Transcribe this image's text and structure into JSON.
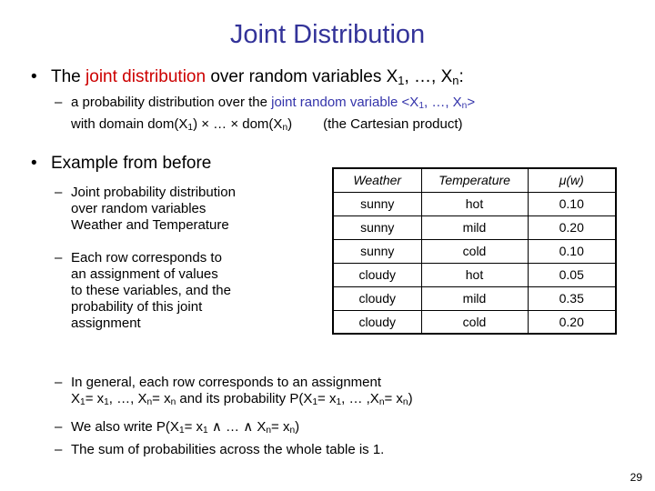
{
  "slide": {
    "title": "Joint Distribution",
    "page_number": "29",
    "colors": {
      "title": "#333399",
      "highlight_red": "#cc0000",
      "highlight_blue": "#3333aa",
      "text": "#000000",
      "background": "#ffffff"
    }
  },
  "bullets": {
    "b1_the_joint": {
      "marker": "•",
      "pre": "The ",
      "highlight": "joint distribution",
      "post_a": " over random variables X",
      "sub_1": "1",
      "post_b": ", …, X",
      "sub_n": "n",
      "post_c": ":"
    },
    "b2_probability_dist": {
      "marker": "–",
      "pre": "a probability distribution over the ",
      "highlight": "joint random variable <X",
      "sub_1": "1",
      "highlight_b": ", …, X",
      "sub_n": "n",
      "highlight_c": ">"
    },
    "b2_with_domain": {
      "pre": "with domain dom(X",
      "sub_1": "1",
      "mid": ") × … × dom(X",
      "sub_n": "n",
      "post": ")",
      "parenthetical": "(the Cartesian product)"
    },
    "b1_example": {
      "marker": "•",
      "text": "Example from before"
    },
    "b2_joint_prob": {
      "marker": "–",
      "line1": "Joint probability distribution",
      "line2": "over random variables",
      "line3": "Weather and Temperature"
    },
    "b2_each_row": {
      "marker": "–",
      "line1": "Each row corresponds to",
      "line2": "an assignment of values",
      "line3": "to these variables, and the",
      "line4": "probability of this joint",
      "line5": "assignment"
    },
    "b2_in_general": {
      "marker": "–",
      "line1": "In general, each row corresponds to an assignment",
      "line2_a": "X",
      "line2_sub1": "1",
      "line2_b": "= x",
      "line2_sub2": "1",
      "line2_c": ", …, X",
      "line2_sub3": "n",
      "line2_d": "= x",
      "line2_sub4": "n",
      "line2_e": " and its probability P(X",
      "line2_sub5": "1",
      "line2_f": "= x",
      "line2_sub6": "1",
      "line2_g": ", … ,X",
      "line2_sub7": "n",
      "line2_h": "= x",
      "line2_sub8": "n",
      "line2_i": ")"
    },
    "b2_we_also_write": {
      "marker": "–",
      "pre": "We also write P(X",
      "sub_1": "1",
      "mid_a": "= x",
      "sub_2": "1",
      "mid_b": " ∧ … ∧ X",
      "sub_3": "n",
      "mid_c": "= x",
      "sub_4": "n",
      "post": ")"
    },
    "b2_sum": {
      "marker": "–",
      "text": "The sum of probabilities across the whole table is 1."
    }
  },
  "table": {
    "headers": [
      "Weather",
      "Temperature",
      "μ(w)"
    ],
    "rows": [
      [
        "sunny",
        "hot",
        "0.10"
      ],
      [
        "sunny",
        "mild",
        "0.20"
      ],
      [
        "sunny",
        "cold",
        "0.10"
      ],
      [
        "cloudy",
        "hot",
        "0.05"
      ],
      [
        "cloudy",
        "mild",
        "0.35"
      ],
      [
        "cloudy",
        "cold",
        "0.20"
      ]
    ]
  }
}
